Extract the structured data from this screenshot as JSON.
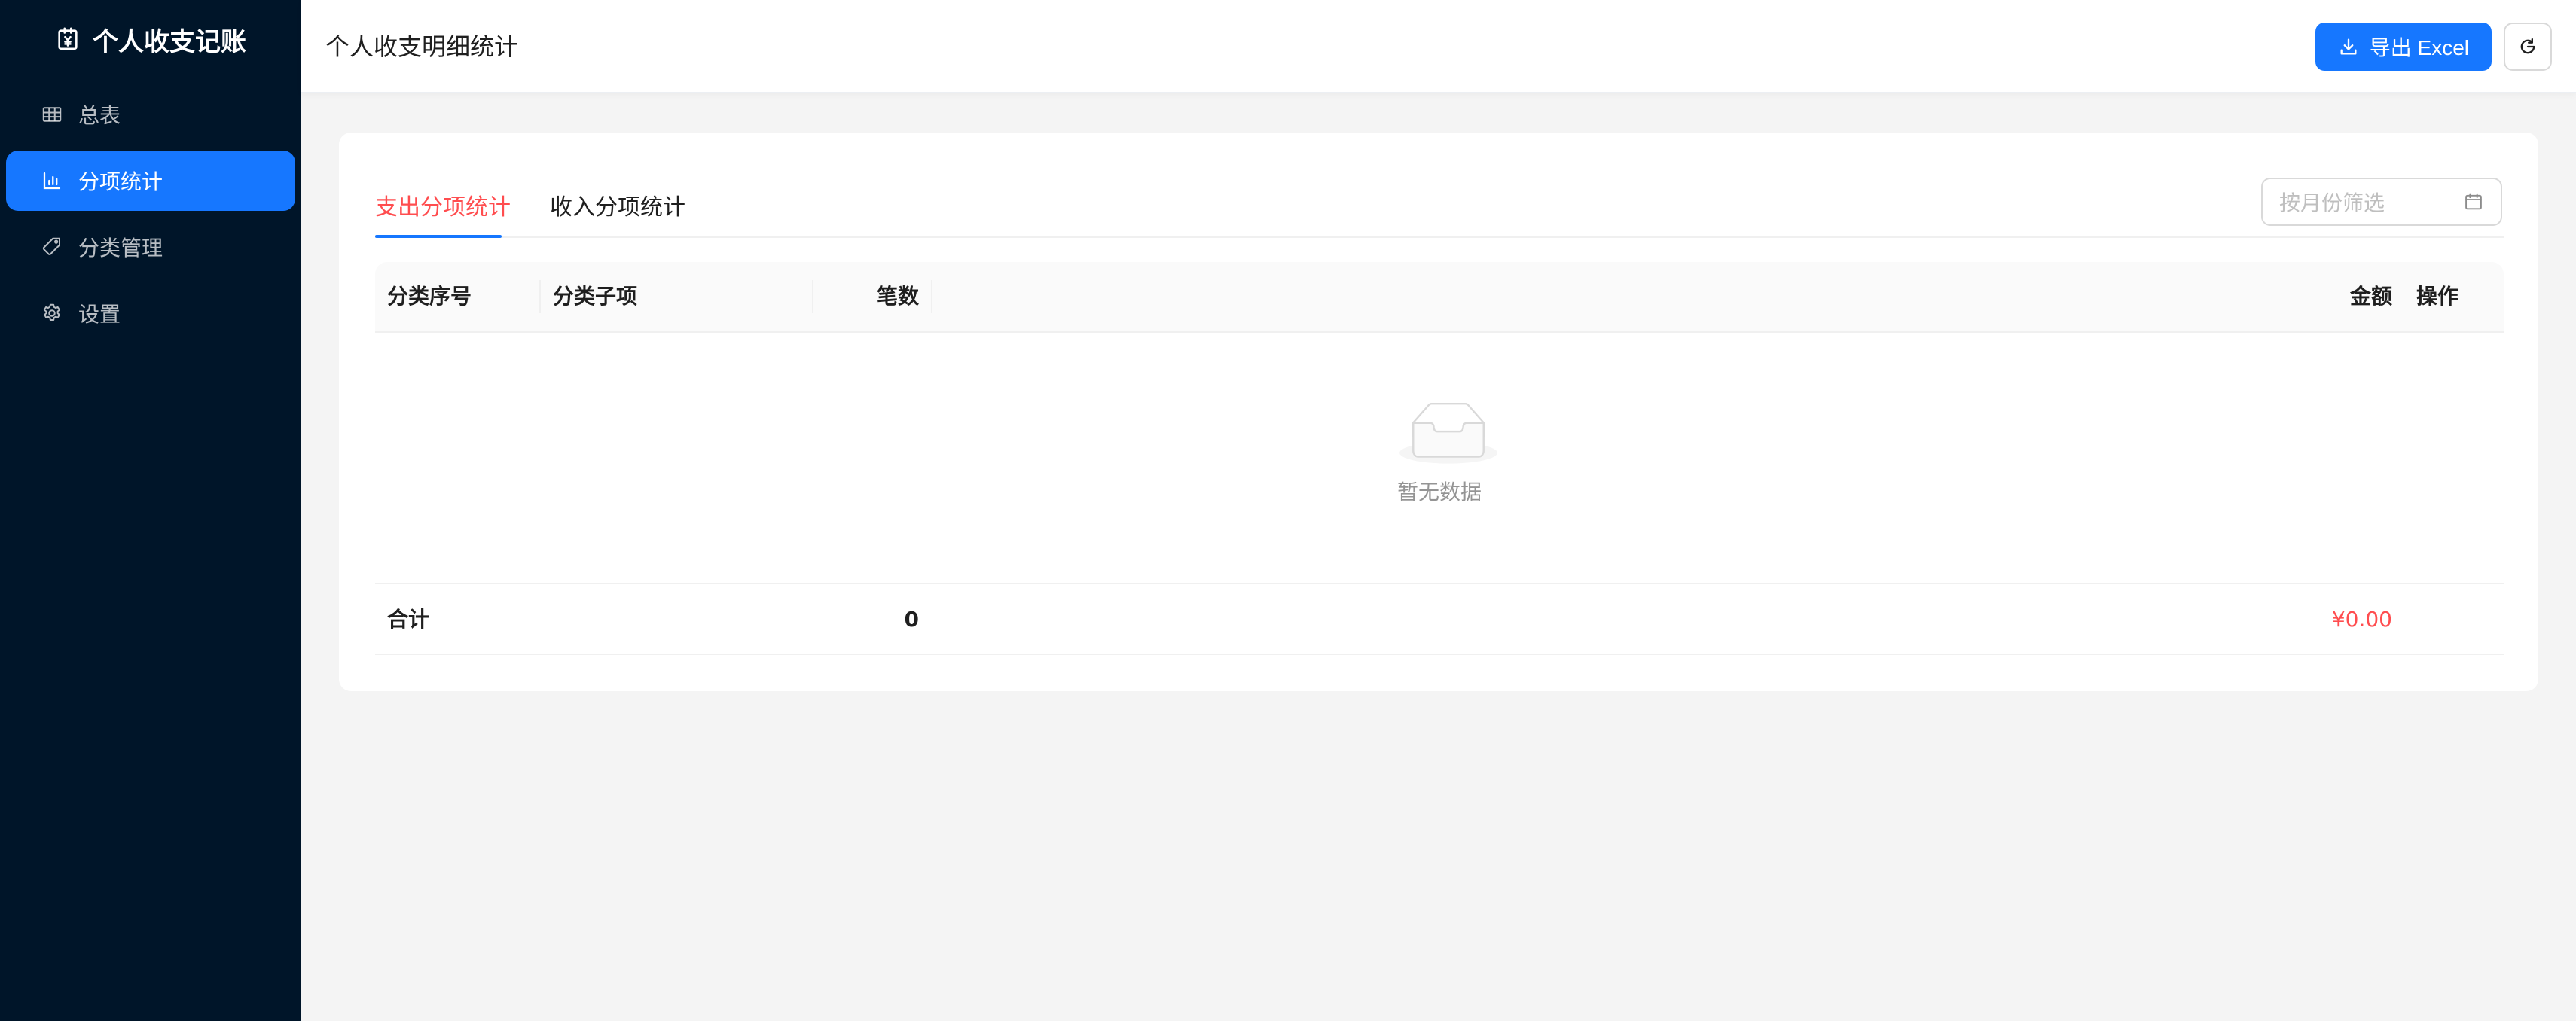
{
  "app": {
    "title": "个人收支记账",
    "logo_icon": "ledger-icon"
  },
  "sidebar": {
    "items": [
      {
        "label": "总表",
        "icon": "table-icon",
        "active": false
      },
      {
        "label": "分项统计",
        "icon": "bar-chart-icon",
        "active": true
      },
      {
        "label": "分类管理",
        "icon": "tag-icon",
        "active": false
      },
      {
        "label": "设置",
        "icon": "gear-icon",
        "active": false
      }
    ]
  },
  "header": {
    "title": "个人收支明细统计",
    "export_label": "导出 Excel",
    "export_icon": "download-icon",
    "refresh_icon": "refresh-icon"
  },
  "tabs": [
    {
      "label": "支出分项统计",
      "active": true
    },
    {
      "label": "收入分项统计",
      "active": false
    }
  ],
  "filter": {
    "month_placeholder": "按月份筛选",
    "icon": "calendar-icon"
  },
  "table": {
    "columns": [
      "分类序号",
      "分类子项",
      "笔数",
      "金额",
      "操作"
    ],
    "empty_text": "暂无数据",
    "summary": {
      "label": "合计",
      "count": "0",
      "amount": "¥0.00"
    }
  },
  "colors": {
    "sidebar_bg": "#001529",
    "primary": "#1677ff",
    "danger": "#ff4d4f",
    "page_bg": "#f4f4f4"
  }
}
